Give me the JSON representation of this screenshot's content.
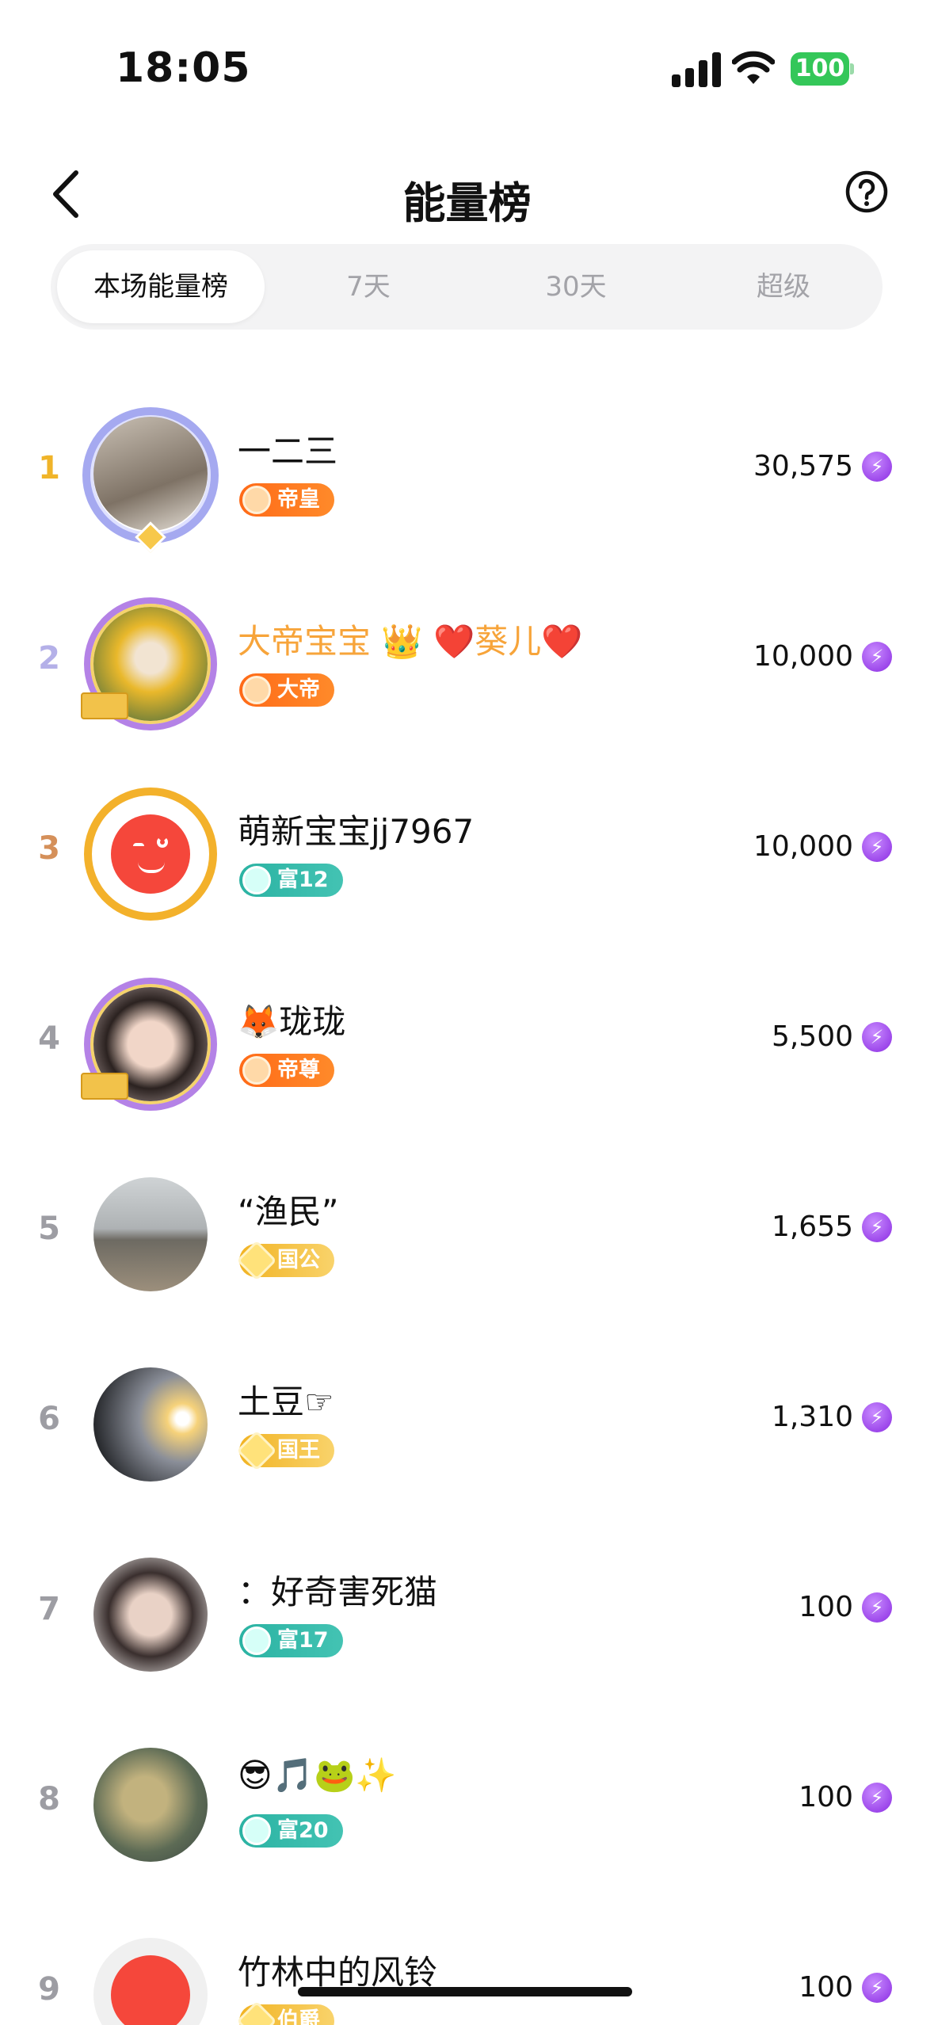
{
  "status_bar": {
    "time": "18:05",
    "battery": "100"
  },
  "nav": {
    "title": "能量榜"
  },
  "tabs": [
    {
      "label": "本场能量榜",
      "active": true
    },
    {
      "label": "7天",
      "active": false
    },
    {
      "label": "30天",
      "active": false
    },
    {
      "label": "超级",
      "active": false
    }
  ],
  "ranking": [
    {
      "rank": "1",
      "name": "一二三",
      "badge": "帝皇",
      "score": "30,575"
    },
    {
      "rank": "2",
      "name": "大帝宝宝 👑 ❤️葵儿❤️",
      "badge": "大帝",
      "score": "10,000"
    },
    {
      "rank": "3",
      "name": "萌新宝宝jj7967",
      "badge": "富12",
      "score": "10,000"
    },
    {
      "rank": "4",
      "name": "🦊珑珑",
      "badge": "帝尊",
      "score": "5,500"
    },
    {
      "rank": "5",
      "name": "“渔民”",
      "badge": "国公",
      "score": "1,655"
    },
    {
      "rank": "6",
      "name": "土豆☞",
      "badge": "国王",
      "score": "1,310"
    },
    {
      "rank": "7",
      "name": "：好奇害死猫",
      "badge": "富17",
      "score": "100"
    },
    {
      "rank": "8",
      "name": "😎🎵🐸✨",
      "badge": "富20",
      "score": "100"
    },
    {
      "rank": "9",
      "name": "竹林中的风铃",
      "badge": "伯爵",
      "score": "100"
    }
  ],
  "colors": {
    "rank1": "#f0b429",
    "rank2": "#b4b0e8",
    "rank3": "#d5905a",
    "rank_other": "#9d9da3",
    "name_highlight": "#f7a43a",
    "energy": "#8a2be2"
  },
  "icons": {
    "back": "chevron-left-icon",
    "help": "question-circle-icon",
    "energy": "lightning-bolt-icon"
  }
}
